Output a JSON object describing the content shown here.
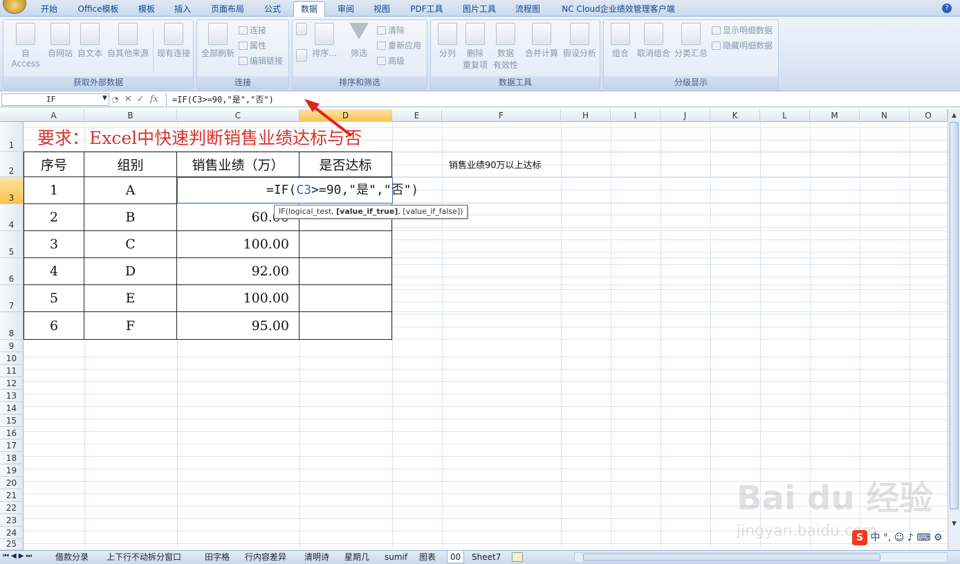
{
  "tabs": [
    "开始",
    "Office模板",
    "模板",
    "插入",
    "页面布局",
    "公式",
    "数据",
    "审阅",
    "视图",
    "PDF工具",
    "图片工具",
    "流程图",
    "NC Cloud企业绩效管理客户端"
  ],
  "active_tab": "数据",
  "ribbon": {
    "ext_group": {
      "label": "获取外部数据",
      "buttons": [
        "自 Access",
        "自网站",
        "自文本",
        "自其他来源",
        "现有连接"
      ]
    },
    "conn_group": {
      "label": "连接",
      "refresh": "全部刷新",
      "small": [
        "连接",
        "属性",
        "编辑链接"
      ]
    },
    "sort_group": {
      "label": "排序和筛选",
      "sort": "排序...",
      "filter": "筛选",
      "small": [
        "清除",
        "重新应用",
        "高级"
      ]
    },
    "tools_group": {
      "label": "数据工具",
      "buttons": [
        "分列",
        "删除\n重复项",
        "数据\n有效性",
        "合并计算",
        "假设分析"
      ]
    },
    "outline_group": {
      "label": "分级显示",
      "buttons": [
        "组合",
        "取消组合",
        "分类汇总"
      ],
      "small": [
        "显示明细数据",
        "隐藏明细数据"
      ]
    }
  },
  "formula_bar": {
    "name_box": "IF",
    "fx_label": "fx",
    "formula": "=IF(C3>=90,\"是\",\"否\")"
  },
  "columns": [
    "A",
    "B",
    "C",
    "D",
    "E",
    "F",
    "H",
    "I",
    "J",
    "K",
    "L",
    "M",
    "N",
    "O"
  ],
  "rows": [
    "1",
    "2",
    "3",
    "4",
    "5",
    "6",
    "7",
    "8",
    "9",
    "10",
    "11",
    "12",
    "13",
    "14",
    "15",
    "16",
    "17",
    "18",
    "19",
    "20",
    "21",
    "22",
    "23",
    "24",
    "25"
  ],
  "sheet": {
    "title": "要求：Excel中快速判断销售业绩达标与否",
    "headers": [
      "序号",
      "组别",
      "销售业绩（万）",
      "是否达标"
    ],
    "data": [
      {
        "no": "1",
        "group": "A",
        "sales": ""
      },
      {
        "no": "2",
        "group": "B",
        "sales": "60.00"
      },
      {
        "no": "3",
        "group": "C",
        "sales": "100.00"
      },
      {
        "no": "4",
        "group": "D",
        "sales": "92.00"
      },
      {
        "no": "5",
        "group": "E",
        "sales": "100.00"
      },
      {
        "no": "6",
        "group": "F",
        "sales": "95.00"
      }
    ],
    "note": "销售业绩90万以上达标",
    "editing": {
      "prefix": "=IF(",
      "ref": "C3",
      "suffix": ">=90,\"是\",\"否\")"
    },
    "tooltip": {
      "a": "IF(logical_test, ",
      "b": "[value_if_true]",
      "c": ", [value_if_false])"
    }
  },
  "sheet_tabs": [
    "借款分录",
    "上下行不动拆分窗口",
    "田字格",
    "行内容差异",
    "清明诗",
    "星期几",
    "sumif",
    "图表",
    "00",
    "Sheet7"
  ],
  "active_sheet": "00",
  "watermark": {
    "main": "Bai du 经验",
    "sub": "jingyan.baidu.com"
  },
  "ime": {
    "logo": "S",
    "text": "中 °, ☺ ♪ ⌨ ⚙"
  }
}
